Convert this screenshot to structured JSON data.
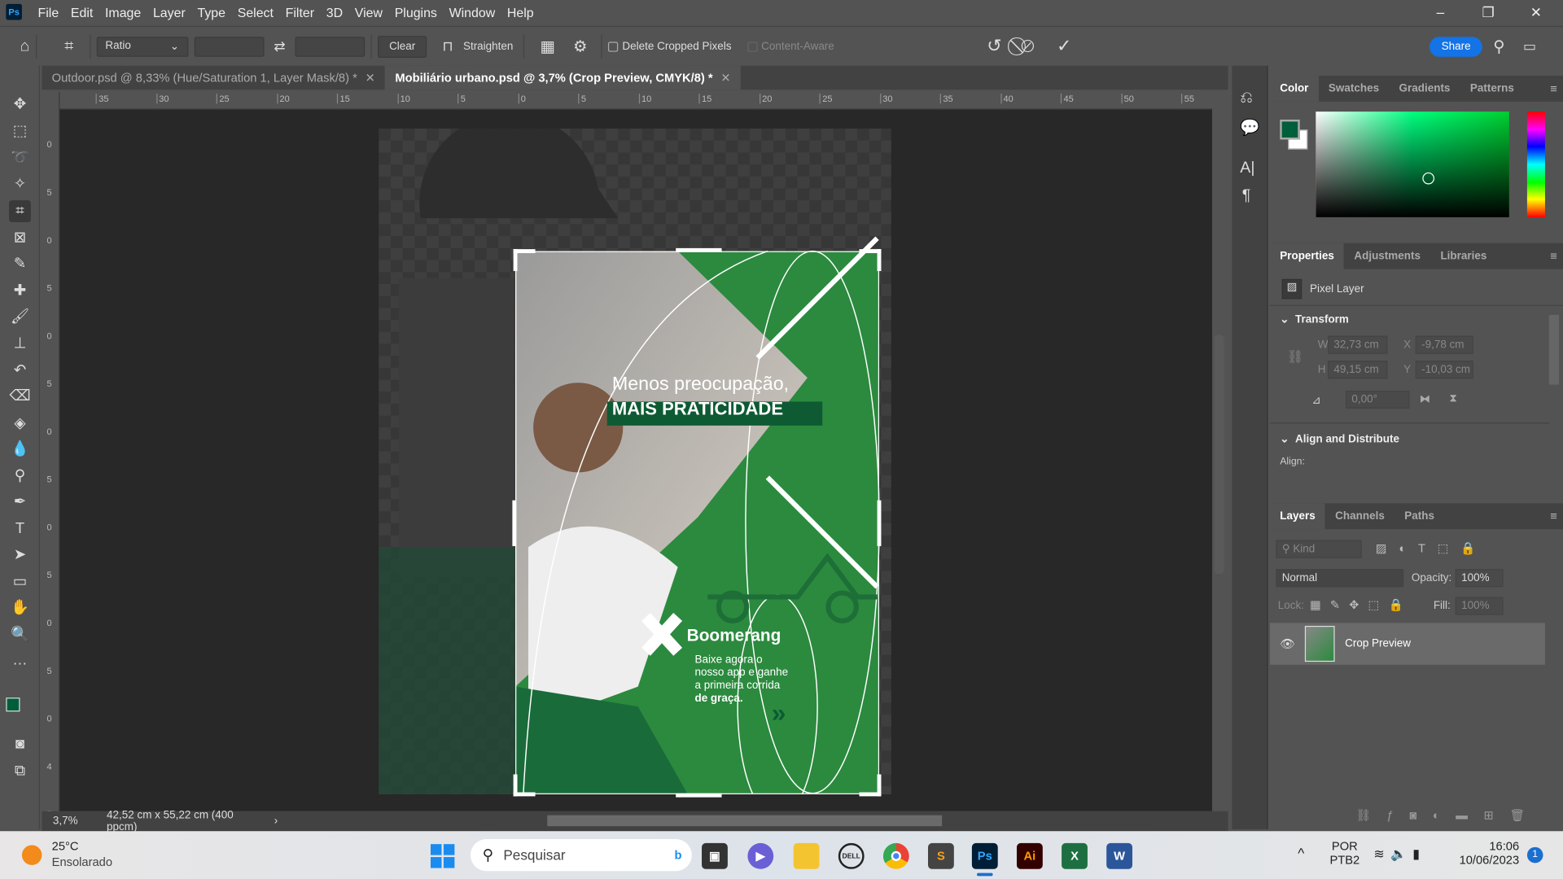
{
  "app": {
    "logo": "Ps"
  },
  "menu": [
    "File",
    "Edit",
    "Image",
    "Layer",
    "Type",
    "Select",
    "Filter",
    "3D",
    "View",
    "Plugins",
    "Window",
    "Help"
  ],
  "options": {
    "ratio": "Ratio",
    "clear": "Clear",
    "straighten": "Straighten",
    "delete_cropped": "Delete Cropped Pixels",
    "content_aware": "Content-Aware",
    "share": "Share"
  },
  "tabs": [
    {
      "label": "Outdoor.psd @ 8,33% (Hue/Saturation 1, Layer Mask/8) *",
      "active": false
    },
    {
      "label": "Mobiliário urbano.psd @ 3,7% (Crop Preview, CMYK/8) *",
      "active": true
    }
  ],
  "ruler_h": [
    "35",
    "30",
    "25",
    "20",
    "15",
    "10",
    "5",
    "0",
    "5",
    "10",
    "15",
    "20",
    "25",
    "30",
    "35",
    "40",
    "45",
    "50",
    "55"
  ],
  "ruler_v": [
    "0",
    "5",
    "0",
    "5",
    "0",
    "5",
    "0",
    "5",
    "0",
    "5",
    "0",
    "5",
    "0",
    "4",
    "5"
  ],
  "poster": {
    "line1": "Menos preocupação,",
    "line2": "MAIS PRATICIDADE",
    "brand": "Boomerang",
    "cta1": "Baixe agora o",
    "cta2": "nosso app e ganhe",
    "cta3": "a primeira corrida",
    "cta4": "de graça.",
    "arrows": "»"
  },
  "status": {
    "zoom": "3,7%",
    "doc_size": "42,52 cm x 55,22 cm (400 ppcm)"
  },
  "color_panel": {
    "tabs": [
      "Color",
      "Swatches",
      "Gradients",
      "Patterns"
    ],
    "foreground": "#005e3a",
    "background": "#ffffff"
  },
  "properties": {
    "tabs": [
      "Properties",
      "Adjustments",
      "Libraries"
    ],
    "layer_type": "Pixel Layer",
    "transform_title": "Transform",
    "w_label": "W",
    "w": "32,73 cm",
    "h_label": "H",
    "h": "49,15 cm",
    "x_label": "X",
    "x": "-9,78 cm",
    "y_label": "Y",
    "y": "-10,03 cm",
    "angle": "0,00°",
    "align_title": "Align and Distribute",
    "align_label": "Align:"
  },
  "layers": {
    "tabs": [
      "Layers",
      "Channels",
      "Paths"
    ],
    "kind": "Kind",
    "blend": "Normal",
    "opacity_label": "Opacity:",
    "opacity": "100%",
    "lock_label": "Lock:",
    "fill_label": "Fill:",
    "fill": "100%",
    "items": [
      {
        "name": "Crop Preview",
        "visible": true
      }
    ]
  },
  "taskbar": {
    "temp": "25°C",
    "weather": "Ensolarado",
    "search": "Pesquisar",
    "lang1": "POR",
    "lang2": "PTB2",
    "time": "16:06",
    "date": "10/06/2023",
    "notif": "1"
  }
}
